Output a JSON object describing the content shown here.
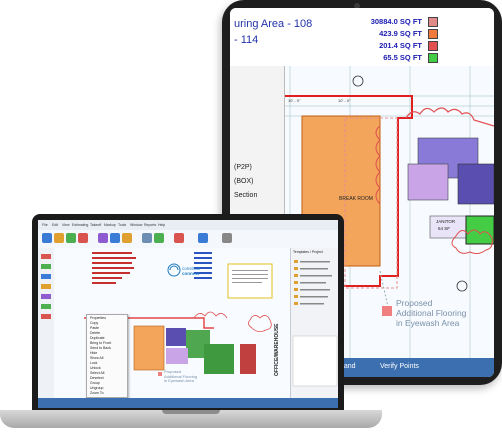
{
  "tablet": {
    "header_title": "uring Area - 108",
    "header_sub": "- 114",
    "measurements": [
      {
        "value": "30884.0 SQ FT",
        "color": "#e08a8a"
      },
      {
        "value": "423.9 SQ FT",
        "color": "#f07a3a"
      },
      {
        "value": "201.4 SQ FT",
        "color": "#e05050"
      },
      {
        "value": "65.5 SQ FT",
        "color": "#44cc44"
      }
    ],
    "context_menu": [
      "(P2P)",
      "(BOX)",
      "Section"
    ],
    "rooms": {
      "break_room": "BREAK ROOM",
      "janitor": "JANITOR",
      "janitor_area": "64 SF"
    },
    "callout": [
      "Proposed",
      "Additional Flooring",
      "in Eyewash Area"
    ],
    "status_bar": [
      "hand",
      "Verify Points"
    ]
  },
  "laptop": {
    "menu": [
      "File",
      "Edit",
      "View",
      "Estimating",
      "Takeoff",
      "Markup",
      "Tools",
      "Window",
      "Reports",
      "Help"
    ],
    "toolbar_buttons": [
      {
        "color": "#3a7bd5"
      },
      {
        "color": "#e0a030"
      },
      {
        "color": "#4caf50"
      },
      {
        "color": "#d9534f"
      },
      {
        "color": "#8e5bd0"
      },
      {
        "color": "#3a7bd5"
      },
      {
        "color": "#e0a030"
      },
      {
        "color": "#6d8fb3"
      },
      {
        "color": "#4caf50"
      },
      {
        "color": "#d9534f"
      },
      {
        "color": "#3a7bd5"
      },
      {
        "color": "#888888"
      }
    ],
    "logo_line1": "construct",
    "logo_line2": "connect",
    "vertical_label": "OFFICE/WAREHOUSE",
    "callout": [
      "Proposed",
      "Additional Flooring",
      "in Eyewash Area"
    ],
    "context_menu_items": [
      "Properties",
      "Copy",
      "Paste",
      "Delete",
      "Duplicate",
      "Bring to Front",
      "Send to Back",
      "Hide",
      "Show All",
      "Lock",
      "Unlock",
      "Select All",
      "Deselect",
      "Group",
      "Ungroup",
      "Zoom To"
    ],
    "right_panel_title": "Templates / Project"
  }
}
